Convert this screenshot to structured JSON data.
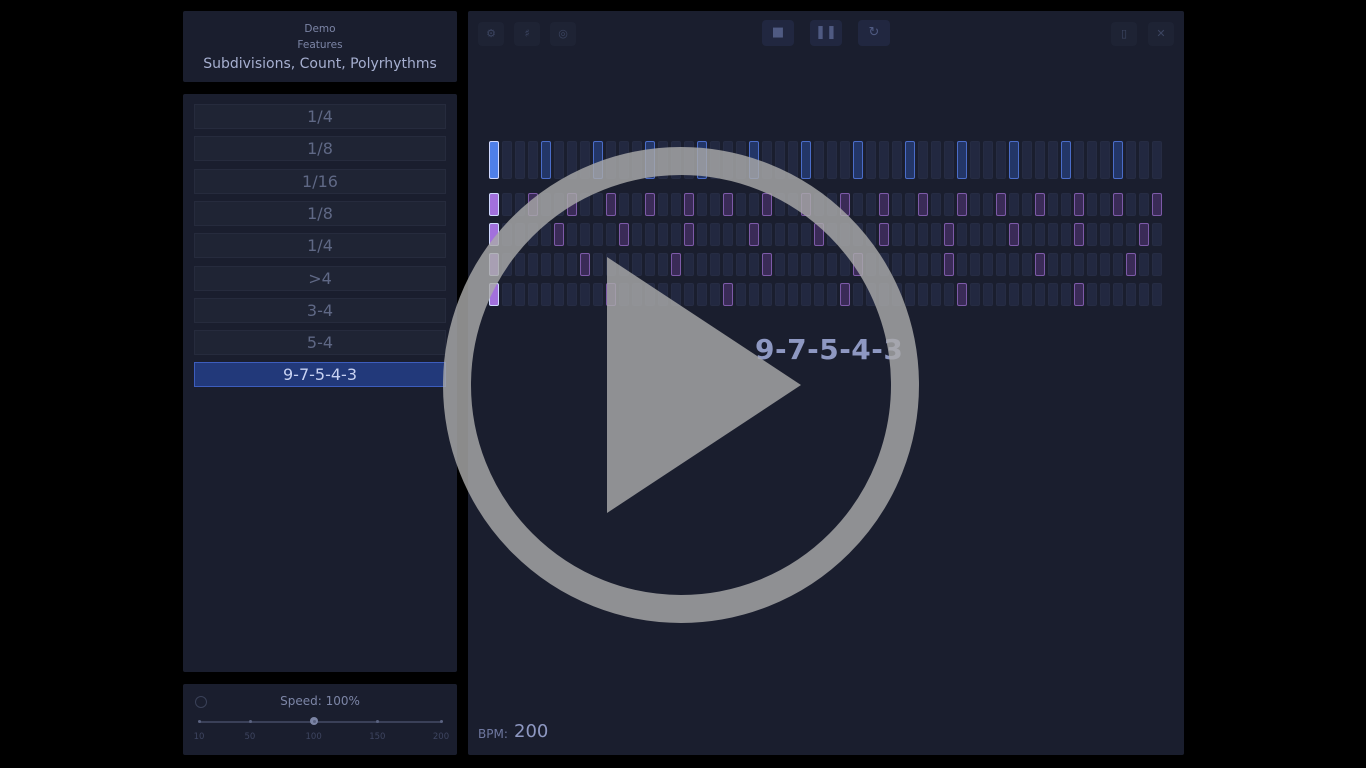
{
  "header": {
    "line1": "Demo",
    "line2": "Features",
    "title": "Subdivisions, Count, Polyrhythms"
  },
  "presets": [
    {
      "label": "1/4",
      "active": false
    },
    {
      "label": "1/8",
      "active": false
    },
    {
      "label": "1/16",
      "active": false
    },
    {
      "label": "1/8",
      "active": false
    },
    {
      "label": "1/4",
      "active": false
    },
    {
      "label": ">4",
      "active": false
    },
    {
      "label": "3-4",
      "active": false
    },
    {
      "label": "5-4",
      "active": false
    },
    {
      "label": "9-7-5-4-3",
      "active": true
    }
  ],
  "speed": {
    "label": "Speed: 100%",
    "value": 100,
    "min": 10,
    "max": 200,
    "ticks": [
      "10",
      "50",
      "100",
      "150",
      "200"
    ]
  },
  "toolbar": {
    "left": [
      "settings-icon",
      "tuner-icon",
      "timer-icon"
    ],
    "center": [
      "stop-icon",
      "pause-icon",
      "reset-icon"
    ],
    "right": [
      "mouse-icon",
      "fullscreen-icon"
    ]
  },
  "sequencer": {
    "steps": 52,
    "rows": [
      {
        "subdivision": 4,
        "accent": "#4a78e6",
        "big": true
      },
      {
        "subdivision": 3,
        "accent": "#9b60d6",
        "big": false
      },
      {
        "subdivision": 5,
        "accent": "#9b60d6",
        "big": false
      },
      {
        "subdivision": 7,
        "accent": "#9b60d6",
        "big": false
      },
      {
        "subdivision": 9,
        "accent": "#9b60d6",
        "big": false
      }
    ],
    "pattern_name": "9-7-5-4-3"
  },
  "bpm": {
    "label": "BPM:",
    "value": "200"
  },
  "colors": {
    "background": "#000000",
    "panel": "#1a1e2e",
    "active": "#22397a",
    "beat": "#4a78e6",
    "poly": "#9b60d6"
  }
}
